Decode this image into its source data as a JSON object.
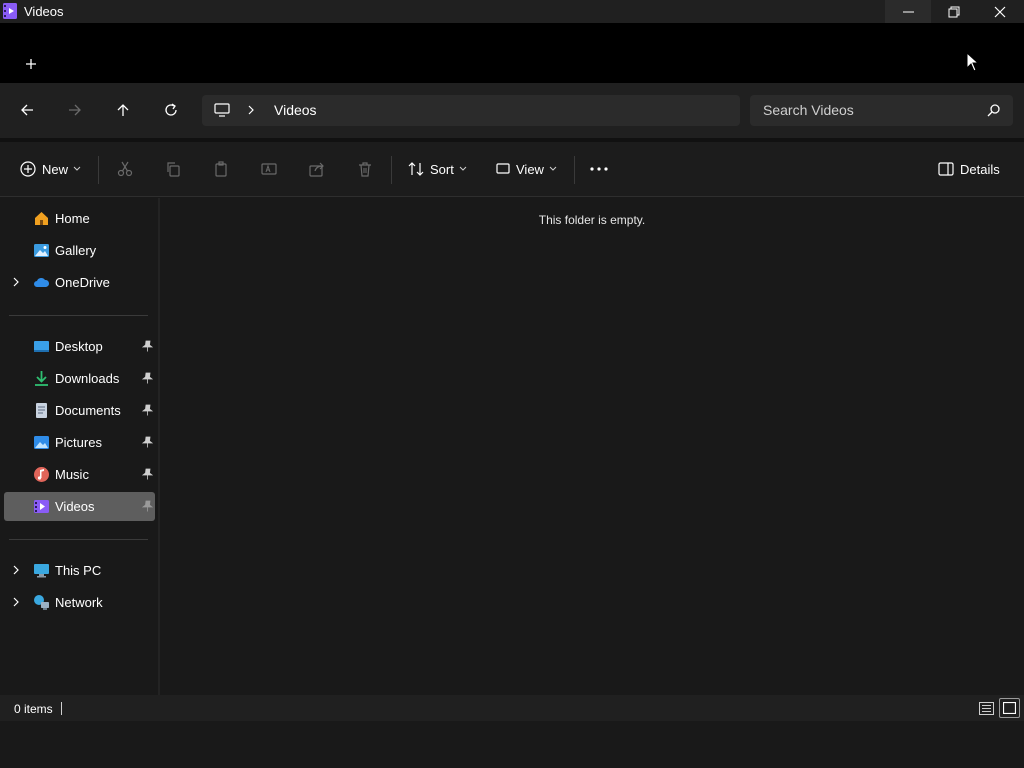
{
  "window": {
    "title": "Videos",
    "accent": "#8a5cf6"
  },
  "navigation": {
    "breadcrumb": [
      "Videos"
    ],
    "search_placeholder": "Search Videos"
  },
  "commandbar": {
    "new_label": "New",
    "sort_label": "Sort",
    "view_label": "View",
    "details_label": "Details"
  },
  "sidebar": {
    "top": [
      {
        "label": "Home",
        "icon": "home-icon"
      },
      {
        "label": "Gallery",
        "icon": "gallery-icon"
      },
      {
        "label": "OneDrive",
        "icon": "onedrive-icon"
      }
    ],
    "quick_access": [
      {
        "label": "Desktop",
        "icon": "desktop-icon"
      },
      {
        "label": "Downloads",
        "icon": "downloads-icon"
      },
      {
        "label": "Documents",
        "icon": "documents-icon"
      },
      {
        "label": "Pictures",
        "icon": "pictures-icon"
      },
      {
        "label": "Music",
        "icon": "music-icon"
      },
      {
        "label": "Videos",
        "icon": "videos-icon",
        "selected": true
      }
    ],
    "bottom": [
      {
        "label": "This PC",
        "icon": "this-pc-icon"
      },
      {
        "label": "Network",
        "icon": "network-icon"
      }
    ]
  },
  "content": {
    "empty_message": "This folder is empty."
  },
  "statusbar": {
    "item_count": "0 items"
  }
}
